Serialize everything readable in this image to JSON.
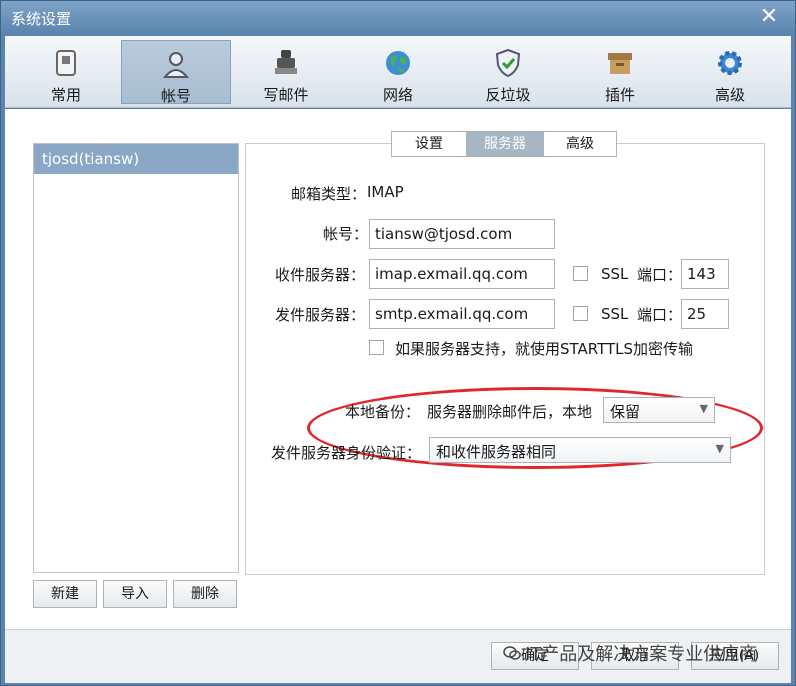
{
  "window": {
    "title": "系统设置"
  },
  "toolbar": {
    "items": [
      {
        "label": "常用",
        "icon": "switch-icon"
      },
      {
        "label": "帐号",
        "icon": "user-icon"
      },
      {
        "label": "写邮件",
        "icon": "stamp-icon"
      },
      {
        "label": "网络",
        "icon": "globe-icon"
      },
      {
        "label": "反垃圾",
        "icon": "shield-icon"
      },
      {
        "label": "插件",
        "icon": "box-icon"
      },
      {
        "label": "高级",
        "icon": "gear-icon"
      }
    ],
    "active": "帐号"
  },
  "accounts": {
    "items": [
      "tjosd(tiansw)"
    ],
    "buttons": {
      "new": "新建",
      "import": "导入",
      "delete": "删除"
    }
  },
  "tabs": {
    "settings": "设置",
    "server": "服务器",
    "advanced": "高级",
    "selected": "服务器"
  },
  "form": {
    "mailbox_type_label": "邮箱类型：",
    "mailbox_type_value": "IMAP",
    "account_label": "帐号：",
    "account_value": "tiansw@tjosd.com",
    "incoming_label": "收件服务器：",
    "incoming_value": "imap.exmail.qq.com",
    "incoming_ssl": "SSL",
    "incoming_port_label": "端口：",
    "incoming_port_value": "143",
    "outgoing_label": "发件服务器：",
    "outgoing_value": "smtp.exmail.qq.com",
    "outgoing_ssl": "SSL",
    "outgoing_port_label": "端口：",
    "outgoing_port_value": "25",
    "starttls_label": "如果服务器支持，就使用STARTTLS加密传输",
    "backup_label": "本地备份：",
    "backup_desc": "服务器删除邮件后，本地",
    "backup_value": "保留",
    "auth_label": "发件服务器身份验证：",
    "auth_value": "和收件服务器相同"
  },
  "footer": {
    "ok": "确定",
    "cancel": "取消",
    "apply": "应用(A)",
    "watermark": "IT产品及解决方案专业供应商"
  },
  "colors": {
    "highlight_ellipse": "#e2262a",
    "title_bar": "#5a84ad",
    "selected_account": "#8aa7c6"
  }
}
